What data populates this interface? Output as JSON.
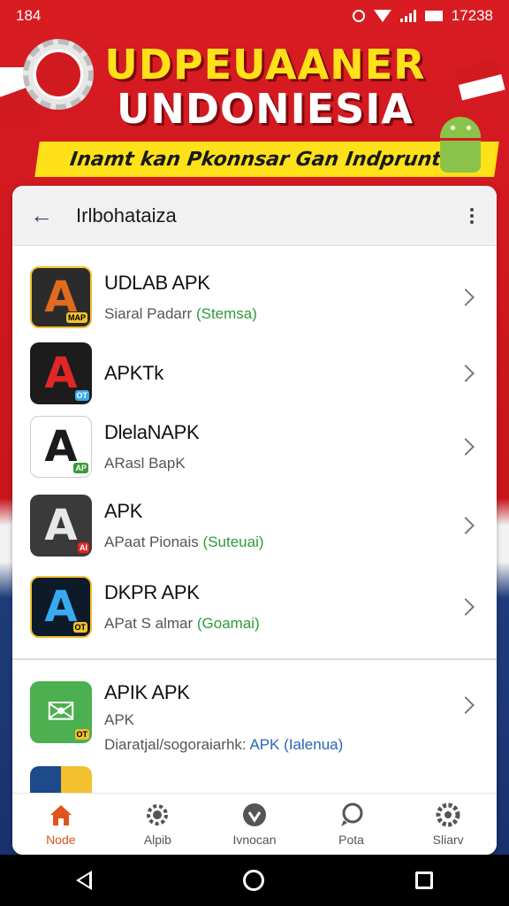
{
  "status_bar": {
    "time": "184",
    "clock_right": "17238"
  },
  "banner": {
    "title_line1": "UDPEUAANER",
    "title_line2": "UNDONIESIA",
    "tagline": "Inamt kan Pkonnsar Gan Indpruntar"
  },
  "header": {
    "title": "Irlbohataiza"
  },
  "apps": [
    {
      "name": "UDLAB APK",
      "sub_main": "Siaral Padarr",
      "sub_accent": "(Stemsa)",
      "icon_bg": "#2b2b2b",
      "icon_glyph": "A",
      "icon_color": "#e06a1e",
      "icon_tag": "MAP"
    },
    {
      "name": "APKTk",
      "sub_main": "",
      "sub_accent": "",
      "icon_bg": "#1c1c1c",
      "icon_glyph": "A",
      "icon_color": "#e02626",
      "icon_tag": "OT"
    },
    {
      "name": "DlelaNAPK",
      "sub_main": "ARasl BapK",
      "sub_accent": "",
      "icon_bg": "#ffffff",
      "icon_glyph": "A",
      "icon_color": "#1a1a1a",
      "icon_tag": "AP"
    },
    {
      "name": "APK",
      "sub_main": "APaat Pionais",
      "sub_accent": "(Suteuai)",
      "icon_bg": "#3a3a3a",
      "icon_glyph": "A",
      "icon_color": "#e8e8e8",
      "icon_tag": "AI"
    },
    {
      "name": "DKPR APK",
      "sub_main": "APat S almar",
      "sub_accent": "(Goamai)",
      "icon_bg": "#0d1a2a",
      "icon_glyph": "A",
      "icon_color": "#3aaaf0",
      "icon_tag": "OT"
    },
    {
      "name": "APIK APK",
      "sub_main": "APK",
      "sub_line3": "Diaratjal/sogoraiarhk:",
      "sub_blue": "APK (Ialenua)",
      "icon_bg": "#4caf50",
      "icon_glyph": "",
      "icon_color": "#ffffff",
      "icon_tag": "OT"
    }
  ],
  "bottom_nav": [
    {
      "label": "Node",
      "icon": "home-icon",
      "active": true
    },
    {
      "label": "Alpib",
      "icon": "gear-badge-icon",
      "active": false
    },
    {
      "label": "Ivnocan",
      "icon": "shield-icon",
      "active": false
    },
    {
      "label": "Pota",
      "icon": "chat-icon",
      "active": false
    },
    {
      "label": "Sliarv",
      "icon": "settings-icon",
      "active": false
    }
  ],
  "colors": {
    "accent_red": "#d81c22",
    "accent_yellow": "#ffe11a",
    "nav_active": "#e0531d",
    "sub_green": "#2e9a3a",
    "sub_blue": "#2a64b8"
  }
}
